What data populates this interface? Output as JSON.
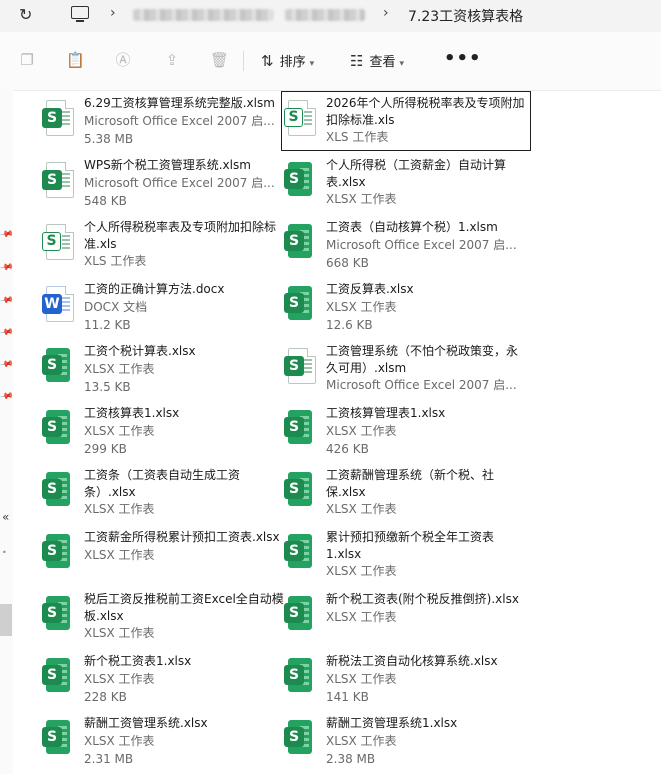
{
  "addressbar": {
    "current_folder": "7.23工资核算表格"
  },
  "toolbar": {
    "sort_label": "排序",
    "view_label": "查看",
    "more_label": "•••"
  },
  "files": [
    {
      "name": "6.29工资核算管理系统完整版.xlsm",
      "type": "Microsoft Office Excel 2007 启...",
      "size": "5.38 MB",
      "icon": "excel-macro-file-icon",
      "selected": false
    },
    {
      "name": "2026年个人所得税税率表及专项附加扣除标准.xls",
      "type": "XLS 工作表",
      "size": "",
      "icon": "xls-file-icon",
      "selected": true
    },
    {
      "name": "WPS新个税工资管理系统.xlsm",
      "type": "Microsoft Office Excel 2007 启...",
      "size": "548 KB",
      "icon": "excel-macro-file-icon",
      "selected": false
    },
    {
      "name": "个人所得税（工资薪金）自动计算表.xlsx",
      "type": "XLSX 工作表",
      "size": "",
      "icon": "xlsx-file-icon",
      "selected": false
    },
    {
      "name": "个人所得税税率表及专项附加扣除标准.xls",
      "type": "XLS 工作表",
      "size": "",
      "icon": "xls-file-icon",
      "selected": false
    },
    {
      "name": "工资表（自动核算个税）1.xlsm",
      "type": "Microsoft Office Excel 2007 启...",
      "size": "668 KB",
      "icon": "xlsx-file-icon",
      "selected": false
    },
    {
      "name": "工资的正确计算方法.docx",
      "type": "DOCX 文档",
      "size": "11.2 KB",
      "icon": "word-file-icon",
      "selected": false
    },
    {
      "name": "工资反算表.xlsx",
      "type": "XLSX 工作表",
      "size": "12.6 KB",
      "icon": "xlsx-file-icon",
      "selected": false
    },
    {
      "name": "工资个税计算表.xlsx",
      "type": "XLSX 工作表",
      "size": "13.5 KB",
      "icon": "xlsx-file-icon",
      "selected": false
    },
    {
      "name": "工资管理系统（不怕个税政策变，永久可用）.xlsm",
      "type": "Microsoft Office Excel 2007 启...",
      "size": "",
      "icon": "excel-macro-file-icon",
      "selected": false
    },
    {
      "name": "工资核算表1.xlsx",
      "type": "XLSX 工作表",
      "size": "299 KB",
      "icon": "xlsx-file-icon",
      "selected": false
    },
    {
      "name": "工资核算管理表1.xlsx",
      "type": "XLSX 工作表",
      "size": "426 KB",
      "icon": "xlsx-file-icon",
      "selected": false
    },
    {
      "name": "工资条（工资表自动生成工资条）.xlsx",
      "type": "XLSX 工作表",
      "size": "",
      "icon": "xlsx-file-icon",
      "selected": false
    },
    {
      "name": "工资薪酬管理系统（新个税、社保.xlsx",
      "type": "XLSX 工作表",
      "size": "",
      "icon": "xlsx-file-icon",
      "selected": false
    },
    {
      "name": "工资薪金所得税累计预扣工资表.xlsx",
      "type": "XLSX 工作表",
      "size": "",
      "icon": "xlsx-file-icon",
      "selected": false
    },
    {
      "name": "累计预扣预缴新个税全年工资表1.xlsx",
      "type": "XLSX 工作表",
      "size": "",
      "icon": "xlsx-file-icon",
      "selected": false
    },
    {
      "name": "税后工资反推税前工资Excel全自动模板.xlsx",
      "type": "XLSX 工作表",
      "size": "",
      "icon": "xlsx-file-icon",
      "selected": false
    },
    {
      "name": "新个税工资表(附个税反推倒挤).xlsx",
      "type": "XLSX 工作表",
      "size": "",
      "icon": "xlsx-file-icon",
      "selected": false
    },
    {
      "name": "新个税工资表1.xlsx",
      "type": "XLSX 工作表",
      "size": "228 KB",
      "icon": "xlsx-file-icon",
      "selected": false
    },
    {
      "name": "新税法工资自动化核算系统.xlsx",
      "type": "XLSX 工作表",
      "size": "141 KB",
      "icon": "xlsx-file-icon",
      "selected": false
    },
    {
      "name": "薪酬工资管理系统.xlsx",
      "type": "XLSX 工作表",
      "size": "2.31 MB",
      "icon": "xlsx-file-icon",
      "selected": false
    },
    {
      "name": "薪酬工资管理系统1.xlsx",
      "type": "XLSX 工作表",
      "size": "2.38 MB",
      "icon": "xlsx-file-icon",
      "selected": false
    }
  ]
}
